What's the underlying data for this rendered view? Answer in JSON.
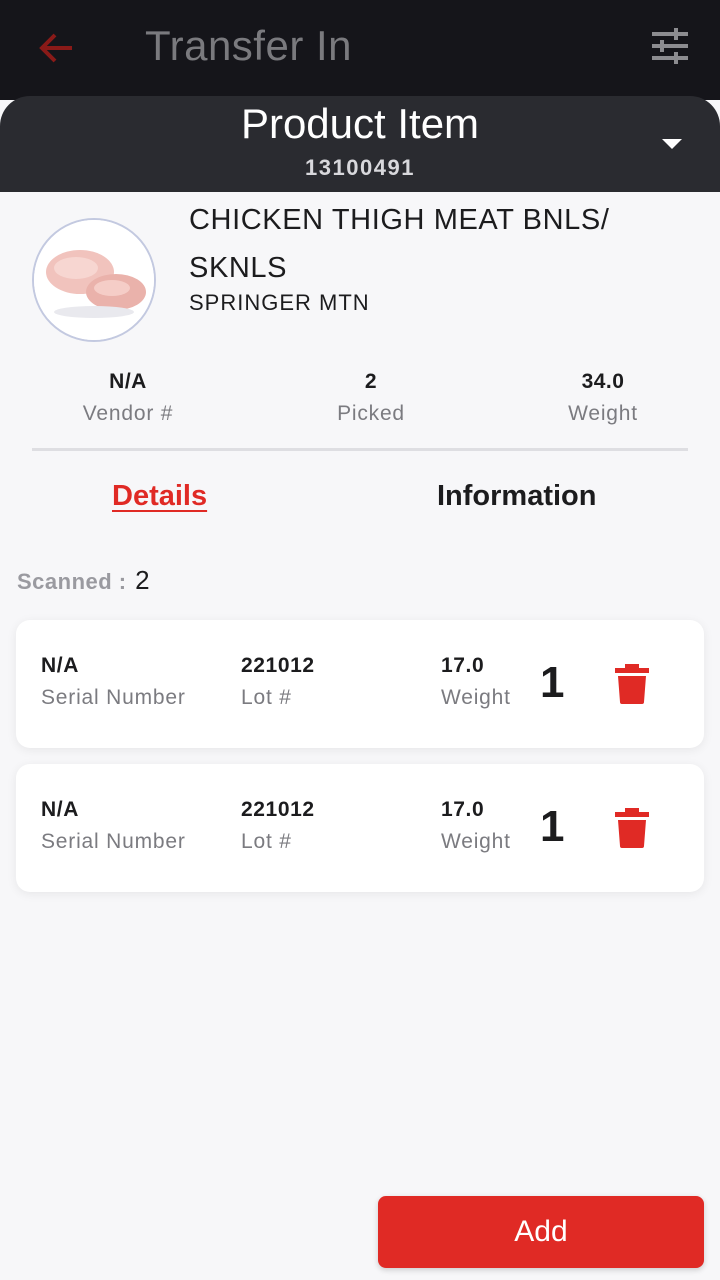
{
  "topbar": {
    "title": "Transfer In",
    "back_icon": "arrow-left-icon",
    "filter_icon": "sliders-icon",
    "accent": "#e02a25"
  },
  "product_header": {
    "title": "Product Item",
    "code": "13100491",
    "dropdown_icon": "caret-down-icon"
  },
  "product": {
    "name": "CHICKEN THIGH MEAT BNLS/ SKNLS",
    "brand": "SPRINGER MTN",
    "image": "chicken-thigh-image",
    "stats": [
      {
        "value": "N/A",
        "label": "Vendor #"
      },
      {
        "value": "2",
        "label": "Picked"
      },
      {
        "value": "34.0",
        "label": "Weight"
      }
    ]
  },
  "tabs": [
    {
      "label": "Details",
      "active": true
    },
    {
      "label": "Information",
      "active": false
    }
  ],
  "scanned": {
    "label": "Scanned :",
    "value": "2"
  },
  "items": [
    {
      "serial": "N/A",
      "serial_label": "Serial Number",
      "lot": "221012",
      "lot_label": "Lot #",
      "weight": "17.0",
      "weight_label": "Weight",
      "qty": "1",
      "delete_icon": "trash-icon"
    },
    {
      "serial": "N/A",
      "serial_label": "Serial Number",
      "lot": "221012",
      "lot_label": "Lot #",
      "weight": "17.0",
      "weight_label": "Weight",
      "qty": "1",
      "delete_icon": "trash-icon"
    }
  ],
  "add_button": {
    "label": "Add"
  }
}
